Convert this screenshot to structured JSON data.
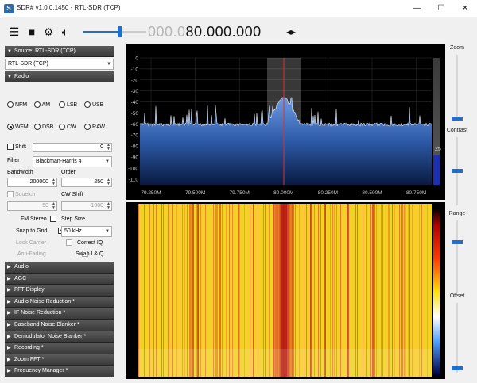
{
  "window": {
    "title": "SDR# v1.0.0.1450 - RTL-SDR (TCP)",
    "minimize": "—",
    "maximize": "☐",
    "close": "✕"
  },
  "toolbar": {
    "freq_dim": "000.0",
    "freq_bright": "80.000.000",
    "freq_arrows": "◂▸",
    "volume_level": 0.58
  },
  "left": {
    "source_header": "Source: RTL-SDR (TCP)",
    "source_value": "RTL-SDR (TCP)",
    "radio_header": "Radio",
    "modes": [
      "NFM",
      "AM",
      "LSB",
      "USB",
      "WFM",
      "DSB",
      "CW",
      "RAW"
    ],
    "selected_mode": "WFM",
    "shift_label": "Shift",
    "shift_value": "0",
    "filter_label": "Filter",
    "filter_value": "Blackman-Harris 4",
    "bandwidth_label": "Bandwidth",
    "bandwidth_value": "200000",
    "order_label": "Order",
    "order_value": "250",
    "squelch_label": "Squelch",
    "squelch_value": "50",
    "cwshift_label": "CW Shift",
    "cwshift_value": "1000",
    "fm_stereo_label": "FM Stereo",
    "step_size_label": "Step Size",
    "snap_label": "Snap to Grid",
    "step_value": "50 kHz",
    "lock_carrier_label": "Lock Carrier",
    "correct_iq_label": "Correct IQ",
    "anti_fading_label": "Anti-Fading",
    "swap_iq_label": "Swap I & Q",
    "collapsed_sections": [
      "Audio",
      "AGC",
      "FFT Display",
      "Audio Noise Reduction *",
      "IF Noise Reduction *",
      "Baseband Noise Blanker *",
      "Demodulator Noise Blanker *",
      "Recording *",
      "Zoom FFT *",
      "Frequency Manager *"
    ]
  },
  "spectrum": {
    "y_ticks": [
      "0",
      "-10",
      "-20",
      "-30",
      "-40",
      "-50",
      "-60",
      "-70",
      "-80",
      "-90",
      "-100",
      "-110"
    ],
    "x_ticks": [
      "79.250M",
      "79.500M",
      "79.750M",
      "80.000M",
      "80.250M",
      "80.500M",
      "80.750M"
    ],
    "level_value": "25"
  },
  "right": {
    "zoom_label": "Zoom",
    "contrast_label": "Contrast",
    "range_label": "Range",
    "offset_label": "Offset"
  },
  "colors": {
    "accent": "#1f6fd1",
    "spectrum_fill_top": "#5b8fd6",
    "spectrum_fill_bottom": "#0a1e4a",
    "center_line": "#e03030",
    "waterfall_base": "#f2d22a",
    "waterfall_line": "#e0541e"
  }
}
